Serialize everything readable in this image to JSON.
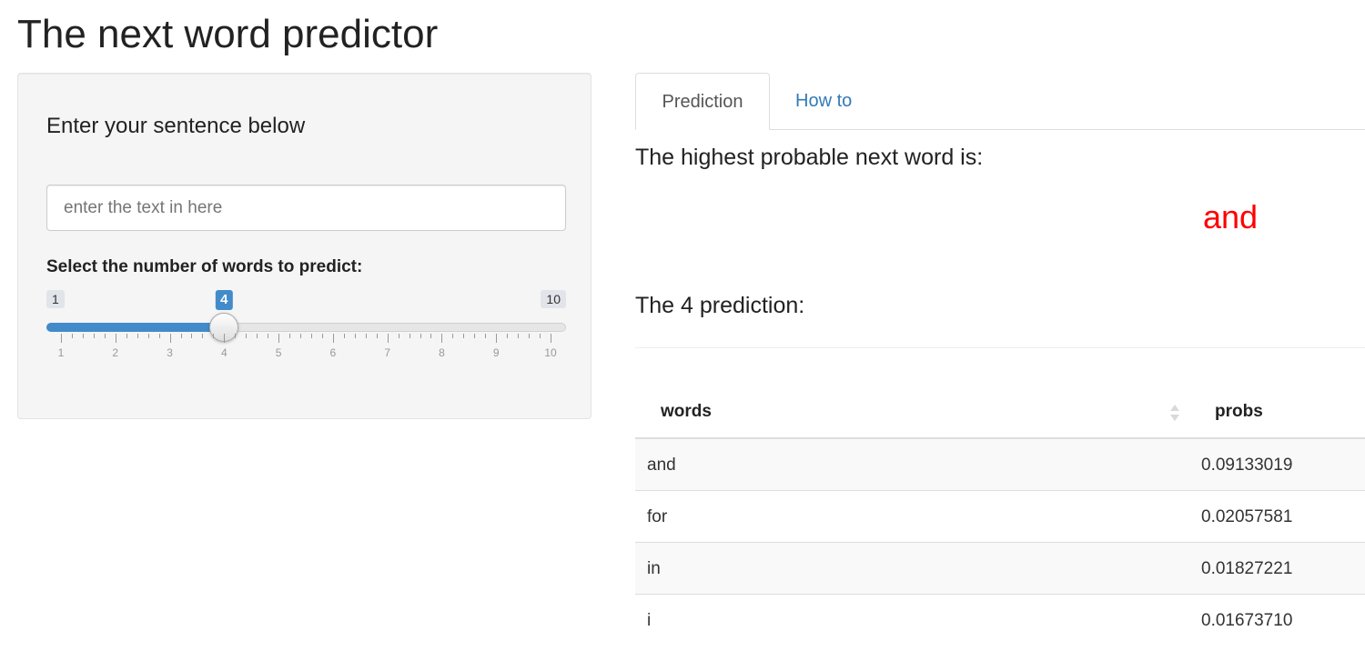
{
  "app": {
    "title": "The next word predictor"
  },
  "sidebar": {
    "heading": "Enter your sentence below",
    "input": {
      "value": "",
      "placeholder": "enter the text in here"
    },
    "slider": {
      "label": "Select the number of words to predict:",
      "min": 1,
      "max": 10,
      "value": 4,
      "min_label": "1",
      "max_label": "10",
      "value_label": "4",
      "tick_labels": [
        "1",
        "2",
        "3",
        "4",
        "5",
        "6",
        "7",
        "8",
        "9",
        "10"
      ]
    }
  },
  "main": {
    "tabs": [
      {
        "label": "Prediction",
        "active": true
      },
      {
        "label": "How to",
        "active": false
      }
    ],
    "best_heading": "The highest probable next word is:",
    "best_word": "and",
    "predictions_heading": "The 4 prediction:",
    "table": {
      "columns": [
        "words",
        "probs"
      ],
      "rows": [
        {
          "words": "and",
          "probs": "0.09133019"
        },
        {
          "words": "for",
          "probs": "0.02057581"
        },
        {
          "words": "in",
          "probs": "0.01827221"
        },
        {
          "words": "i",
          "probs": "0.01673710"
        }
      ]
    }
  },
  "colors": {
    "accent": "#428bca",
    "link": "#337ab7",
    "prediction": "#ff0000"
  },
  "icons": {
    "sort": "sort-arrows-icon"
  }
}
